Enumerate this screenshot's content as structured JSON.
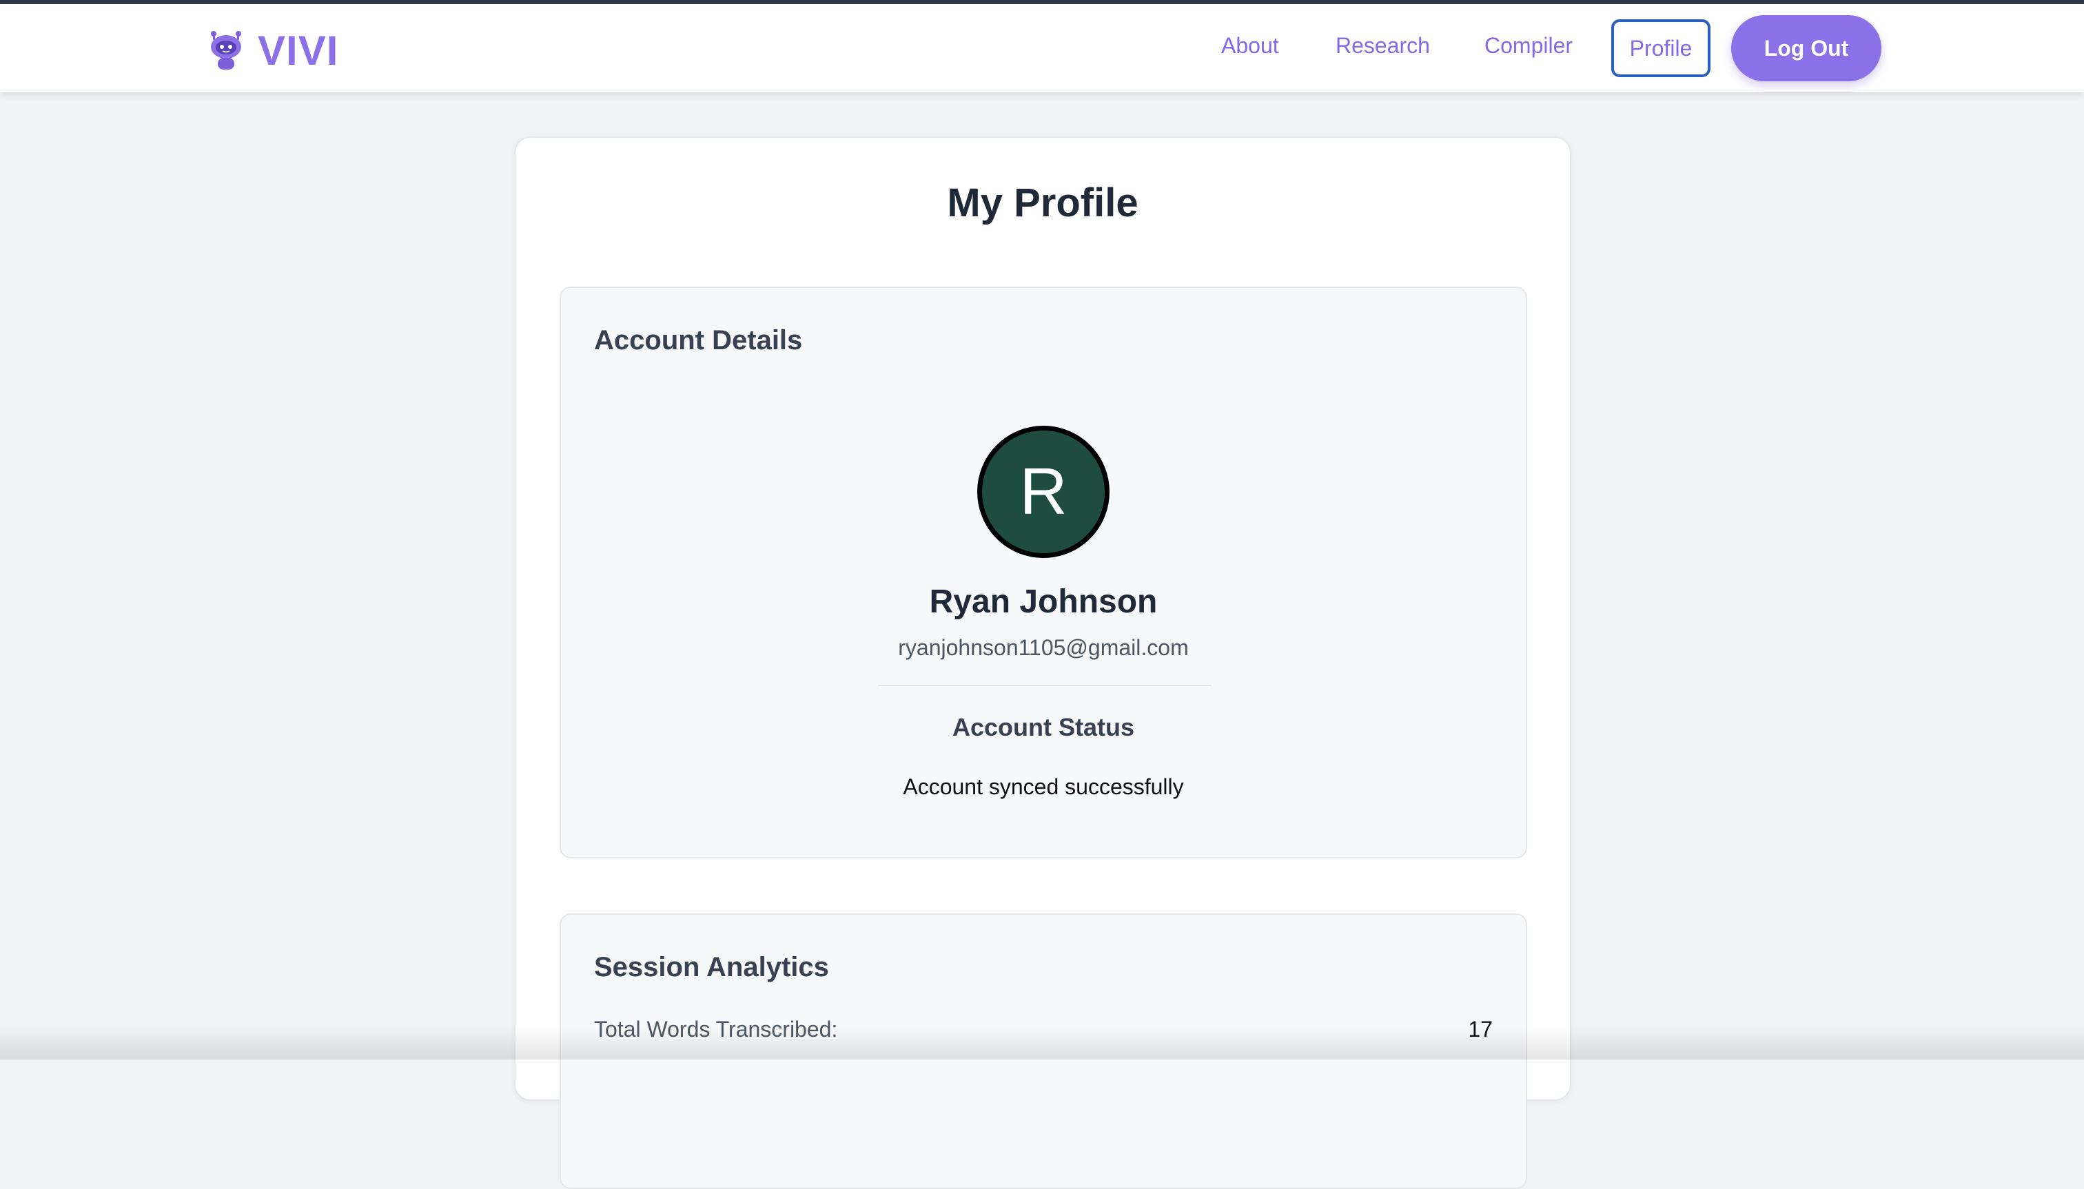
{
  "brand": {
    "name": "VIVI",
    "logo_icon": "robot-mascot-icon"
  },
  "nav": {
    "about": "About",
    "research": "Research",
    "compiler": "Compiler",
    "profile": "Profile",
    "logout": "Log Out"
  },
  "page": {
    "title": "My Profile"
  },
  "account": {
    "heading": "Account Details",
    "avatar_initial": "R",
    "name": "Ryan Johnson",
    "email": "ryanjohnson1105@gmail.com",
    "status_heading": "Account Status",
    "status_text": "Account synced successfully"
  },
  "session": {
    "heading": "Session Analytics",
    "stats": [
      {
        "label": "Total Words Transcribed:",
        "value": "17"
      }
    ]
  },
  "colors": {
    "accent": "#8b70e8",
    "profile_border": "#2b5fc1",
    "avatar_bg": "#1e4d40",
    "page_bg": "#f0f2f5"
  }
}
